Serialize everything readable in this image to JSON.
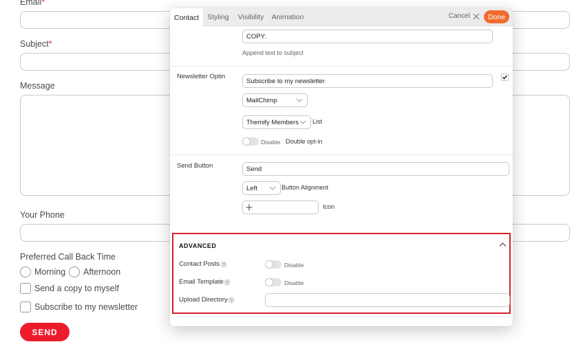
{
  "form": {
    "email_label": "Email",
    "required_mark": "*",
    "subject_label": "Subject",
    "message_label": "Message",
    "phone_label": "Your Phone",
    "callback_label": "Preferred Call Back Time",
    "morning_label": "Morning",
    "afternoon_label": "Afternoon",
    "copy_label": "Send a copy to myself",
    "newsletter_label": "Subscribe to my newsletter",
    "send_label": "SEND"
  },
  "modal": {
    "tabs": [
      {
        "label": "Contact"
      },
      {
        "label": "Styling"
      },
      {
        "label": "Visibility"
      },
      {
        "label": "Animation"
      }
    ],
    "cancel_label": "Cancel",
    "done_label": "Done",
    "copy_subject": {
      "value": "COPY:",
      "help": "Append text to subject"
    },
    "newsletter": {
      "label": "Newsletter Optin",
      "text_value": "Subscribe to my newsletter",
      "checked": true,
      "provider": "MailChimp",
      "list": "Themify Members",
      "list_suffix": "List",
      "toggle_label": "Disable",
      "double_optin_label": "Double opt-in"
    },
    "send_button": {
      "label": "Send Button",
      "value": "Send",
      "alignment": "Left",
      "alignment_label": "Button Alignment",
      "icon_label": "Icon"
    },
    "advanced": {
      "title": "ADVANCED",
      "contact_posts_label": "Contact Posts",
      "contact_posts_toggle": "Disable",
      "email_template_label": "Email Template",
      "email_template_toggle": "Disable",
      "upload_directory_label": "Upload Directory",
      "upload_directory_value": "",
      "help_glyph": "?"
    },
    "colors": {
      "done": "#ef6c2d",
      "send": "#ec1c2c",
      "highlight": "#d4202a"
    }
  }
}
